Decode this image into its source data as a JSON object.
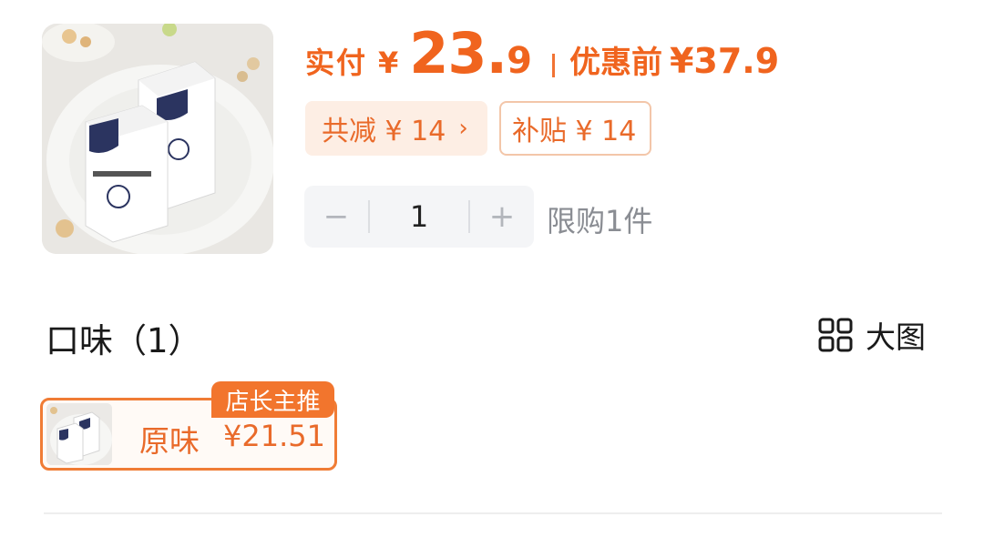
{
  "product": {
    "image_icon": "milk-carton-product-image"
  },
  "price": {
    "pay_label": "实付",
    "currency": "¥",
    "amount_int": "23.",
    "amount_dec": "9",
    "original_label": "优惠前",
    "original_price": "¥37.9"
  },
  "tags": {
    "discount": "共减 ¥ 14",
    "discount_chevron": "›",
    "subsidy": "补贴 ¥ 14"
  },
  "quantity": {
    "minus": "−",
    "value": "1",
    "plus": "+",
    "limit": "限购1件"
  },
  "flavor": {
    "title": "口味（1）",
    "big_image_label": "大图",
    "options": [
      {
        "name": "原味",
        "price": "¥21.51",
        "badge": "店长主推"
      }
    ]
  },
  "colors": {
    "accent": "#f0641e",
    "tag_bg": "#fdeee4",
    "muted": "#8a8d93"
  }
}
